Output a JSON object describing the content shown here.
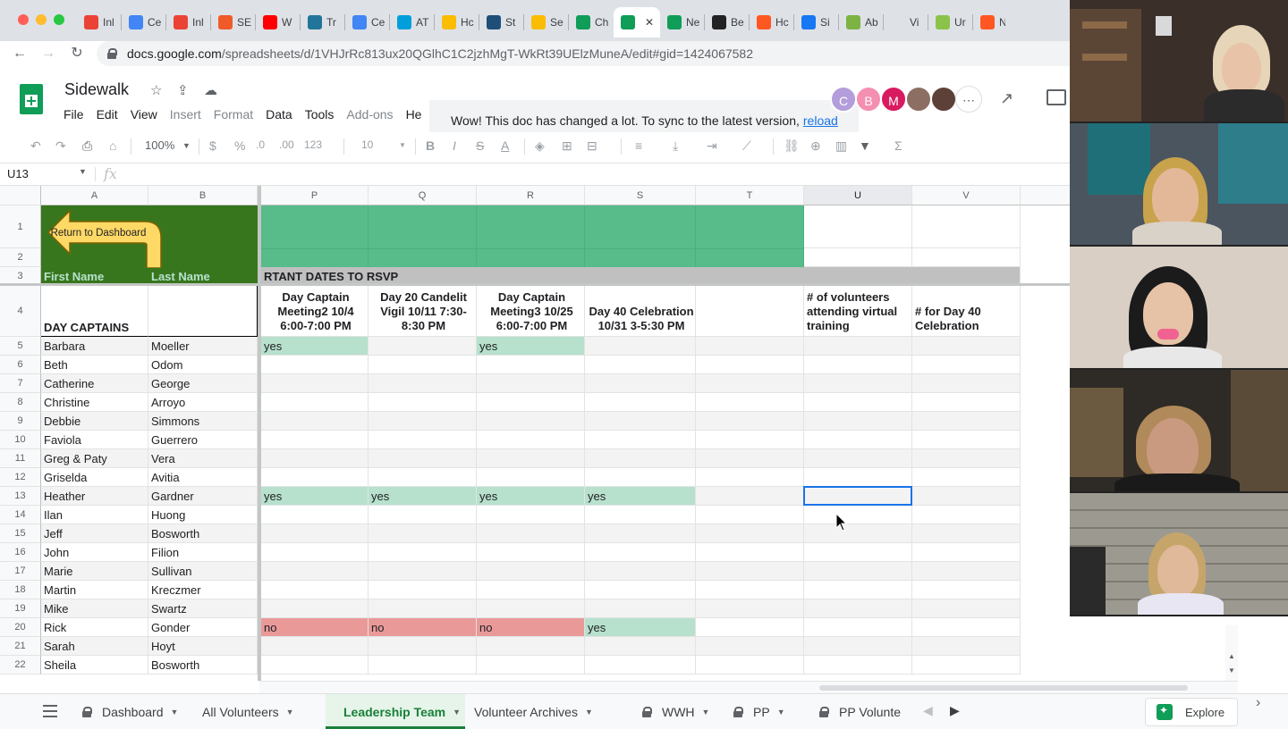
{
  "browser": {
    "tabs": [
      {
        "label": "Inl",
        "icon": "gmail-icon",
        "color": "#ea4335"
      },
      {
        "label": "Ce",
        "icon": "calendar-icon",
        "color": "#4285f4"
      },
      {
        "label": "Inl",
        "icon": "gmail-icon",
        "color": "#ea4335"
      },
      {
        "label": "SE",
        "icon": "ecwid-icon",
        "color": "#f05a28"
      },
      {
        "label": "W",
        "icon": "youtube-icon",
        "color": "#ff0000"
      },
      {
        "label": "Tr",
        "icon": "wordpress-icon",
        "color": "#21759b"
      },
      {
        "label": "Ce",
        "icon": "calendar-icon",
        "color": "#4285f4"
      },
      {
        "label": "AT",
        "icon": "att-icon",
        "color": "#009fdb"
      },
      {
        "label": "Hc",
        "icon": "drive-icon",
        "color": "#fbbc04"
      },
      {
        "label": "St",
        "icon": "globe-icon",
        "color": "#1f4e79"
      },
      {
        "label": "Se",
        "icon": "drive-icon",
        "color": "#fbbc04"
      },
      {
        "label": "Ch",
        "icon": "sheets-icon",
        "color": "#0f9d58"
      },
      {
        "label": "",
        "icon": "sheets-icon",
        "color": "#0f9d58",
        "active": true
      },
      {
        "label": "Ne",
        "icon": "sheets-icon",
        "color": "#0f9d58"
      },
      {
        "label": "Be",
        "icon": "bu-icon",
        "color": "#222222"
      },
      {
        "label": "Hc",
        "icon": "hive-icon",
        "color": "#ff5722"
      },
      {
        "label": "Si",
        "icon": "facebook-icon",
        "color": "#1877f2"
      },
      {
        "label": "Ab",
        "icon": "person-icon",
        "color": "#7cb342"
      },
      {
        "label": "Vi",
        "icon": "blank-icon",
        "color": "#dee1e6"
      },
      {
        "label": "Ur",
        "icon": "play-icon",
        "color": "#8bc34a"
      },
      {
        "label": "N",
        "icon": "hive-icon",
        "color": "#ff5722"
      }
    ],
    "url_host": "docs.google.com",
    "url_path": "/spreadsheets/d/1VHJrRc813ux20QGlhC1C2jzhMgT-WkRt39UElzMuneA/edit#gid=1424067582"
  },
  "doc": {
    "title": "Sidewalk",
    "menus": [
      {
        "label": "File",
        "enabled": true
      },
      {
        "label": "Edit",
        "enabled": true
      },
      {
        "label": "View",
        "enabled": true
      },
      {
        "label": "Insert",
        "enabled": false
      },
      {
        "label": "Format",
        "enabled": false
      },
      {
        "label": "Data",
        "enabled": true
      },
      {
        "label": "Tools",
        "enabled": true
      },
      {
        "label": "Add-ons",
        "enabled": false
      },
      {
        "label": "He",
        "enabled": true
      }
    ],
    "notice_text": "Wow! This doc has changed a lot. To sync to the latest version,",
    "notice_link": "reload",
    "avatars": [
      {
        "initial": "C",
        "color": "#b39ddb"
      },
      {
        "initial": "B",
        "color": "#f48fb1"
      },
      {
        "initial": "M",
        "color": "#d81b60"
      },
      {
        "initial": "",
        "color": "#8d6e63"
      },
      {
        "initial": "",
        "color": "#5d4037"
      }
    ]
  },
  "toolbar": {
    "zoom": "100%",
    "currency": "$",
    "percent": "%",
    "dec0": ".0",
    "dec00": ".00",
    "numfmt": "123",
    "fontsize": "10",
    "bold": "B",
    "italic": "I",
    "strike": "S",
    "textcolor": "A",
    "sum": "Σ"
  },
  "formula": {
    "cell_ref": "U13",
    "fx": "fx"
  },
  "grid": {
    "columns": [
      {
        "id": "A",
        "label": "A"
      },
      {
        "id": "B",
        "label": "B"
      },
      {
        "id": "P",
        "label": "P"
      },
      {
        "id": "Q",
        "label": "Q"
      },
      {
        "id": "R",
        "label": "R"
      },
      {
        "id": "S",
        "label": "S"
      },
      {
        "id": "T",
        "label": "T"
      },
      {
        "id": "U",
        "label": "U"
      },
      {
        "id": "V",
        "label": "V"
      }
    ],
    "return_button": "Return to Dashboard",
    "row3": {
      "first": "First Name",
      "last": "Last Name",
      "banner": "RTANT DATES TO RSVP"
    },
    "row4": {
      "section": "DAY CAPTAINS",
      "P": "Day Captain Meeting2 10/4 6:00-7:00 PM",
      "Q": "Day 20 Candelit Vigil 10/11 7:30-8:30 PM",
      "R": "Day Captain Meeting3 10/25 6:00-7:00 PM",
      "S": "Day 40 Celebration 10/31 3-5:30 PM",
      "U": "# of volunteers attending virtual training",
      "V": "# for Day 40 Celebration"
    },
    "people": [
      {
        "row": "5",
        "first": "Barbara",
        "last": "Moeller",
        "P": "yes",
        "Q": "",
        "R": "yes",
        "S": ""
      },
      {
        "row": "6",
        "first": "Beth",
        "last": "Odom",
        "P": "",
        "Q": "",
        "R": "",
        "S": ""
      },
      {
        "row": "7",
        "first": "Catherine",
        "last": "George",
        "P": "",
        "Q": "",
        "R": "",
        "S": ""
      },
      {
        "row": "8",
        "first": "Christine",
        "last": "Arroyo",
        "P": "",
        "Q": "",
        "R": "",
        "S": ""
      },
      {
        "row": "9",
        "first": "Debbie",
        "last": "Simmons",
        "P": "",
        "Q": "",
        "R": "",
        "S": ""
      },
      {
        "row": "10",
        "first": "Faviola",
        "last": "Guerrero",
        "P": "",
        "Q": "",
        "R": "",
        "S": ""
      },
      {
        "row": "11",
        "first": "Greg & Paty",
        "last": "Vera",
        "P": "",
        "Q": "",
        "R": "",
        "S": ""
      },
      {
        "row": "12",
        "first": "Griselda",
        "last": "Avitia",
        "P": "",
        "Q": "",
        "R": "",
        "S": ""
      },
      {
        "row": "13",
        "first": "Heather",
        "last": "Gardner",
        "P": "yes",
        "Q": "yes",
        "R": "yes",
        "S": "yes"
      },
      {
        "row": "14",
        "first": "Ilan",
        "last": "Huong",
        "P": "",
        "Q": "",
        "R": "",
        "S": ""
      },
      {
        "row": "15",
        "first": "Jeff",
        "last": "Bosworth",
        "P": "",
        "Q": "",
        "R": "",
        "S": ""
      },
      {
        "row": "16",
        "first": "John",
        "last": "Filion",
        "P": "",
        "Q": "",
        "R": "",
        "S": ""
      },
      {
        "row": "17",
        "first": "Marie",
        "last": "Sullivan",
        "P": "",
        "Q": "",
        "R": "",
        "S": ""
      },
      {
        "row": "18",
        "first": "Martin",
        "last": "Kreczmer",
        "P": "",
        "Q": "",
        "R": "",
        "S": ""
      },
      {
        "row": "19",
        "first": "Mike",
        "last": "Swartz",
        "P": "",
        "Q": "",
        "R": "",
        "S": ""
      },
      {
        "row": "20",
        "first": "Rick",
        "last": "Gonder",
        "P": "no",
        "Q": "no",
        "R": "no",
        "S": "yes"
      },
      {
        "row": "21",
        "first": "Sarah",
        "last": "Hoyt",
        "P": "",
        "Q": "",
        "R": "",
        "S": ""
      },
      {
        "row": "22",
        "first": "Sheila",
        "last": "Bosworth",
        "P": "",
        "Q": "",
        "R": "",
        "S": ""
      }
    ],
    "header_rows": [
      "1",
      "2",
      "3",
      "4"
    ],
    "colors": {
      "green_header": "#57bb8a",
      "dark_green": "#38761d",
      "yes": "#b7e1cd",
      "no": "#ea9999",
      "banner": "#c0c0c0"
    }
  },
  "sheets": [
    {
      "label": "Dashboard",
      "locked": true,
      "active": false
    },
    {
      "label": "All Volunteers",
      "locked": false,
      "active": false
    },
    {
      "label": "Leadership Team",
      "locked": false,
      "active": true
    },
    {
      "label": "Volunteer Archives",
      "locked": false,
      "active": false
    },
    {
      "label": "WWH",
      "locked": true,
      "active": false
    },
    {
      "label": "PP",
      "locked": true,
      "active": false
    },
    {
      "label": "PP Volunte",
      "locked": true,
      "active": false
    }
  ],
  "explore_label": "Explore"
}
